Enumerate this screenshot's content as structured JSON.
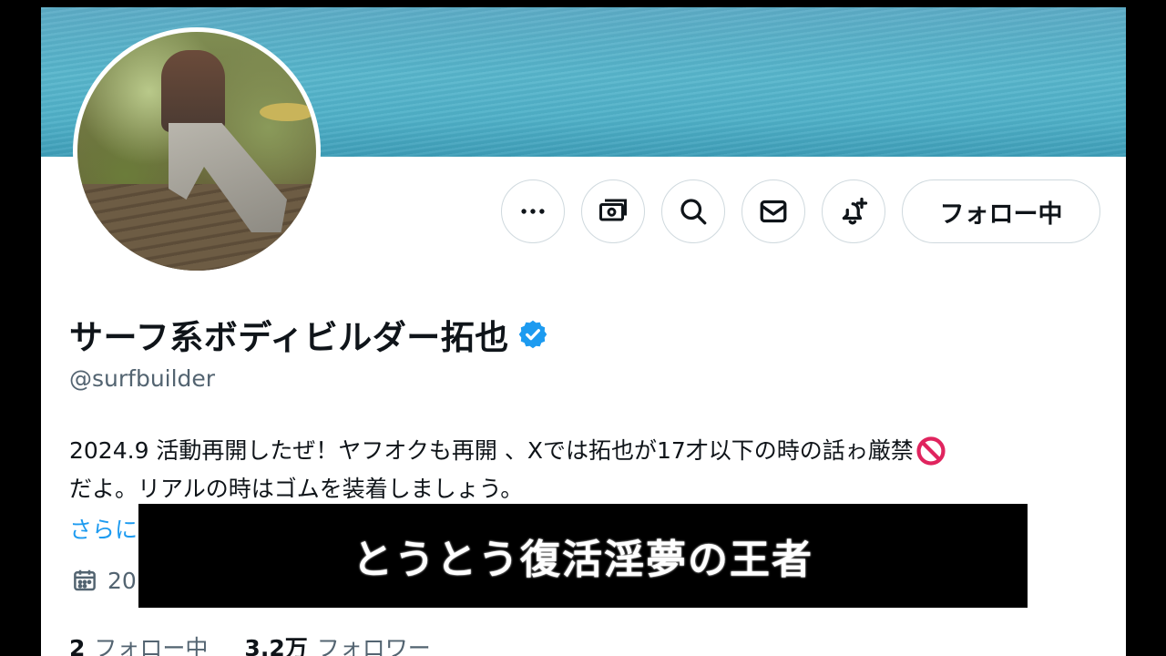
{
  "profile": {
    "display_name": "サーフ系ボディビルダー拓也",
    "handle": "@surfbuilder",
    "bio_line1": "2024.9 活動再開したぜ！ヤフオクも再開 、Xでは拓也が17才以下の時の話ゎ厳禁",
    "bio_line2": "だよ。リアルの時はゴムを装着しましょう。",
    "more_label": "さらに",
    "joined_text": "20"
  },
  "actions": {
    "more_icon": "more-horizontal-icon",
    "subscribe_icon": "money-icon",
    "search_icon": "search-icon",
    "message_icon": "envelope-icon",
    "notify_icon": "bell-plus-icon",
    "follow_label": "フォロー中"
  },
  "stats": {
    "following_count": "2",
    "following_label": "フォロー中",
    "followers_count": "3.2万",
    "followers_label": "フォロワー"
  },
  "caption": {
    "text": "とうとう復活淫夢の王者"
  },
  "colors": {
    "accent": "#1d9bf0",
    "text": "#0f1419",
    "secondary": "#536471",
    "border": "#cfd9de",
    "banner": "#4fb0c8",
    "caption_bg": "#000000"
  }
}
